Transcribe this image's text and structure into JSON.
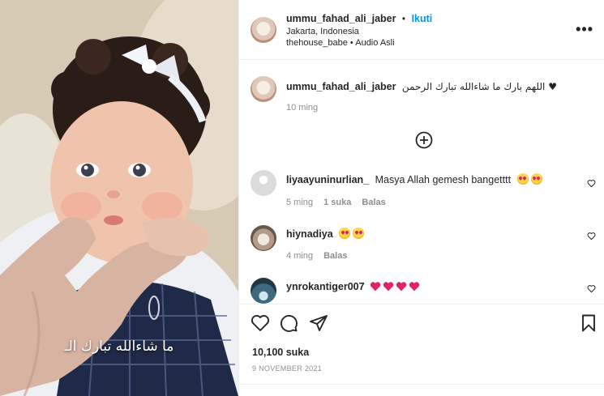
{
  "post": {
    "author": "ummu_fahad_ali_jaber",
    "follow_label": "Ikuti",
    "dot": "•",
    "location": "Jakarta, Indonesia",
    "audio_user": "thehouse_babe",
    "audio_sep": "•",
    "audio_label": "Audio Asli",
    "caption_author": "ummu_fahad_ali_jaber",
    "caption_text": "اللهم بارك ما شاءالله تبارك الرحمن ♥",
    "caption_time": "10 ming",
    "video_overlay_text": "ما شاءالله تبارك الـ",
    "likes": "10,100 suka",
    "date": "9 NOVEMBER 2021"
  },
  "comments": [
    {
      "username": "liyaayuninurlian_",
      "text": "Masya Allah gemesh bangetttt",
      "emoji": [
        "star-struck",
        "heart-eyes"
      ],
      "time": "5 ming",
      "likes": "1 suka",
      "reply": "Balas"
    },
    {
      "username": "hiynadiya",
      "text": "",
      "emoji": [
        "star-struck",
        "heart-eyes"
      ],
      "time": "4 ming",
      "reply": "Balas"
    },
    {
      "username": "ynrokantiger007",
      "text": "",
      "emoji": [
        "red-heart",
        "red-heart",
        "red-heart",
        "red-heart"
      ]
    }
  ],
  "icons": {
    "more": "more-options-icon",
    "load_more": "plus-circle-icon",
    "like": "heart-icon",
    "comment": "comment-icon",
    "share": "send-icon",
    "save": "bookmark-icon"
  },
  "colors": {
    "follow": "#0095f6",
    "text": "#262626",
    "muted": "#8e8e8e",
    "border": "#efefef",
    "heart": "#e0245e"
  }
}
